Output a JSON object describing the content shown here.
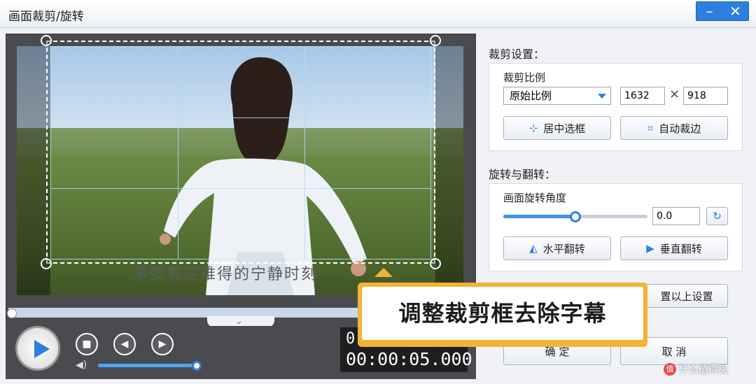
{
  "window": {
    "title": "画面裁剪/旋转",
    "minimize_icon": "minimize-icon",
    "close_icon": "close-icon"
  },
  "preview": {
    "subtitle": "享受着这难得的宁静时刻",
    "time_current_partial": "0",
    "time_total": "00:00:05.000",
    "volume_fraction": 0.95,
    "progress_fraction": 0.0
  },
  "crop": {
    "section_title": "裁剪设置：",
    "ratio_label": "裁剪比例",
    "ratio_value": "原始比例",
    "width": "1632",
    "height": "918",
    "times_sign": "×",
    "center_button": "居中选框",
    "auto_button": "自动裁边"
  },
  "rotate": {
    "section_title": "旋转与翻转：",
    "angle_label": "画面旋转角度",
    "angle_value": "0.0",
    "slider_fraction": 0.5,
    "hflip_button": "水平翻转",
    "vflip_button": "垂直翻转",
    "reset_button_partial": "置以上设置"
  },
  "footer": {
    "ok_button": "确 定",
    "cancel_button": "取 消"
  },
  "callout": {
    "text": "调整裁剪框去除字幕"
  },
  "watermark": {
    "badge": "值",
    "text": "什么值得买"
  },
  "colors": {
    "accent": "#2f7fe0",
    "callout_border": "#f4b332"
  }
}
